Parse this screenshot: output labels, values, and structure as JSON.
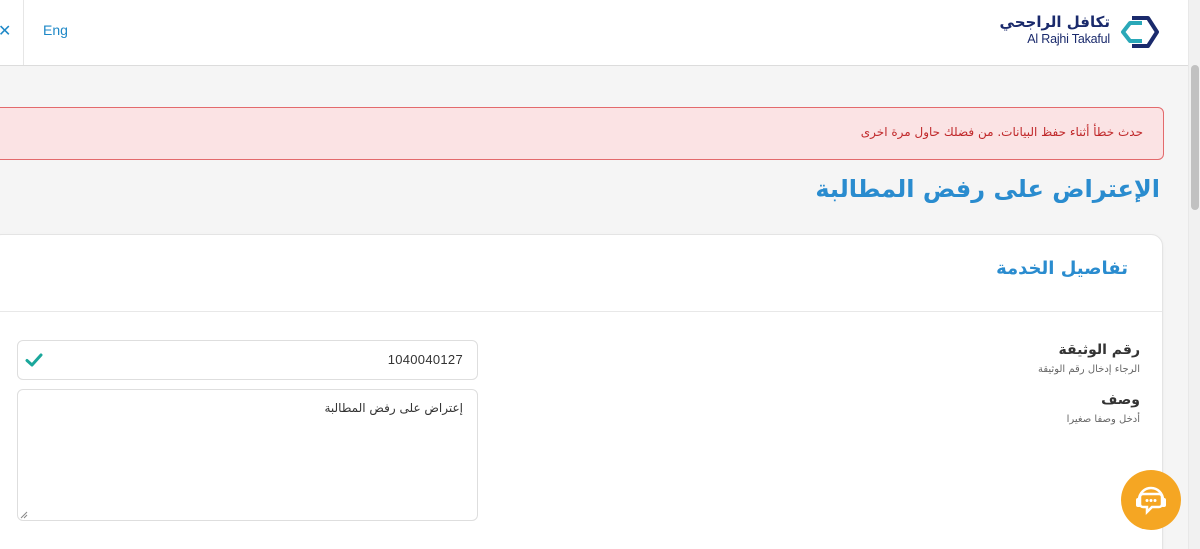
{
  "header": {
    "close_icon": "close-icon",
    "language_label": "Eng",
    "logo": {
      "arabic": "تكافل الراجحي",
      "english": "Al Rajhi Takaful"
    }
  },
  "alert": {
    "message": "حدث خطأ أثناء حفظ البيانات. من فضلك حاول مرة اخرى"
  },
  "page": {
    "title": "الإعتراض على رفض المطالبة"
  },
  "card": {
    "title": "تفاصيل الخدمة",
    "fields": {
      "policy": {
        "label": "رقم الوثيقة",
        "hint": "الرجاء إدخال رقم الوثيقة",
        "value": "1040040127"
      },
      "description": {
        "label": "وصف",
        "hint": "أدخل وصفا صغيرا",
        "value": "إعتراض على رفض المطالبة"
      }
    }
  },
  "colors": {
    "accent": "#2a8ccf",
    "error_bg": "#fbe3e4",
    "error_border": "#e36a6c",
    "error_text": "#c0282a",
    "success_check": "#1aa79b",
    "chat_button": "#f5a623"
  },
  "icons": {
    "check": "check-icon",
    "chat": "chat-support-icon"
  }
}
